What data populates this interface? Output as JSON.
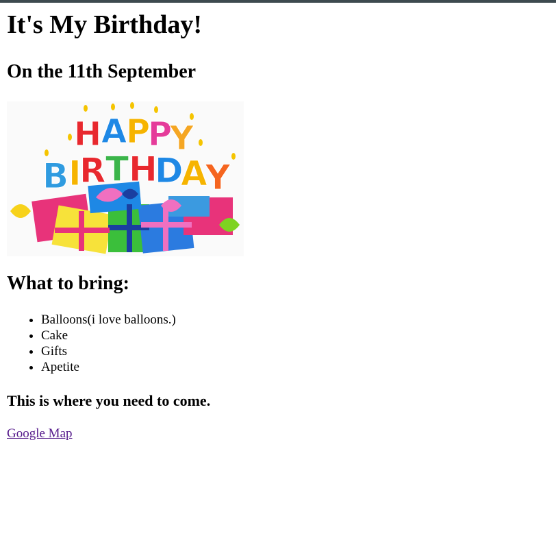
{
  "page": {
    "title": "It's My Birthday!",
    "subtitle": "On the 11th September",
    "banner_image": {
      "alt_text": "HAPPY BIRTHDAY",
      "line1": "HAPPY",
      "line2": "BIRTHDAY"
    },
    "bring_heading": "What to bring:",
    "bring_items": [
      "Balloons(i love balloons.)",
      "Cake",
      "Gifts",
      "Apetite"
    ],
    "location_heading": "This is where you need to come.",
    "map_link": "Google Map"
  },
  "colors": {
    "top_bar": "#3d4a4f",
    "visited_link": "#551a8b",
    "background": "#ffffff"
  }
}
